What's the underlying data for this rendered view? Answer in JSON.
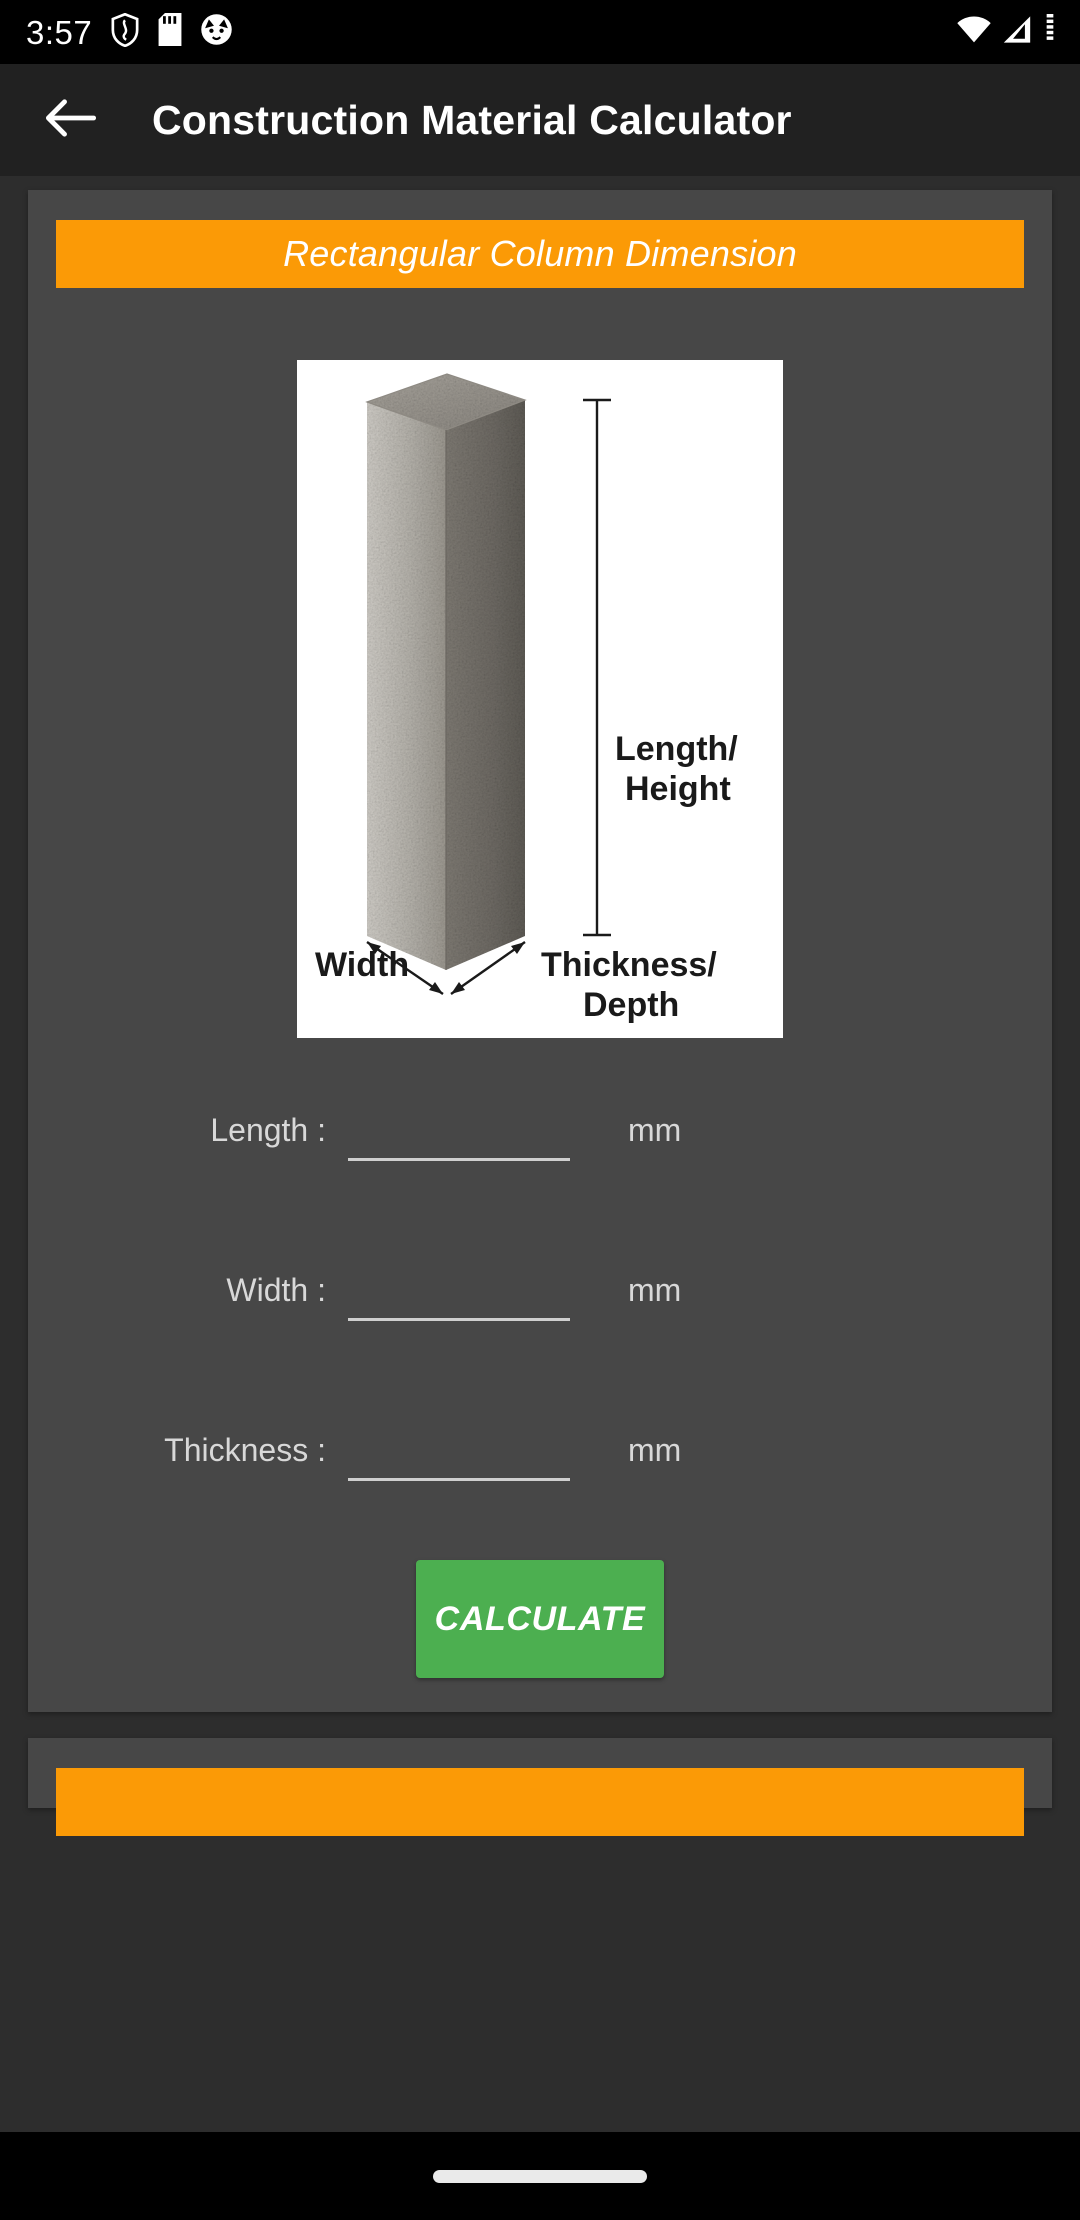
{
  "status_bar": {
    "clock": "3:57",
    "left_icons": [
      "shield-icon",
      "sd-card-icon",
      "cat-face-icon"
    ],
    "right_icons": [
      "wifi-icon",
      "cellular-signal-icon",
      "battery-icon"
    ]
  },
  "app_bar": {
    "back_icon": "back-arrow-icon",
    "title": "Construction Material Calculator"
  },
  "card": {
    "banner_title": "Rectangular Column Dimension",
    "diagram": {
      "label_height": "Length/",
      "label_height2": "Height",
      "label_width": "Width",
      "label_depth": "Thickness/",
      "label_depth2": "Depth"
    },
    "fields": [
      {
        "label": "Length :",
        "value": "",
        "placeholder": "",
        "unit": "mm"
      },
      {
        "label": "Width :",
        "value": "",
        "placeholder": "",
        "unit": "mm"
      },
      {
        "label": "Thickness :",
        "value": "",
        "placeholder": "",
        "unit": "mm"
      }
    ],
    "calculate_label": "CALCULATE"
  },
  "next_card": {
    "banner_title": ""
  },
  "nav_bar": {
    "home_pill": "home-indicator"
  },
  "colors": {
    "accent_orange": "#FB9A06",
    "accent_green": "#4CAF50",
    "card_bg": "#474747",
    "page_bg": "#2d2d2d",
    "app_bar_bg": "#212121",
    "status_bg": "#000000"
  }
}
